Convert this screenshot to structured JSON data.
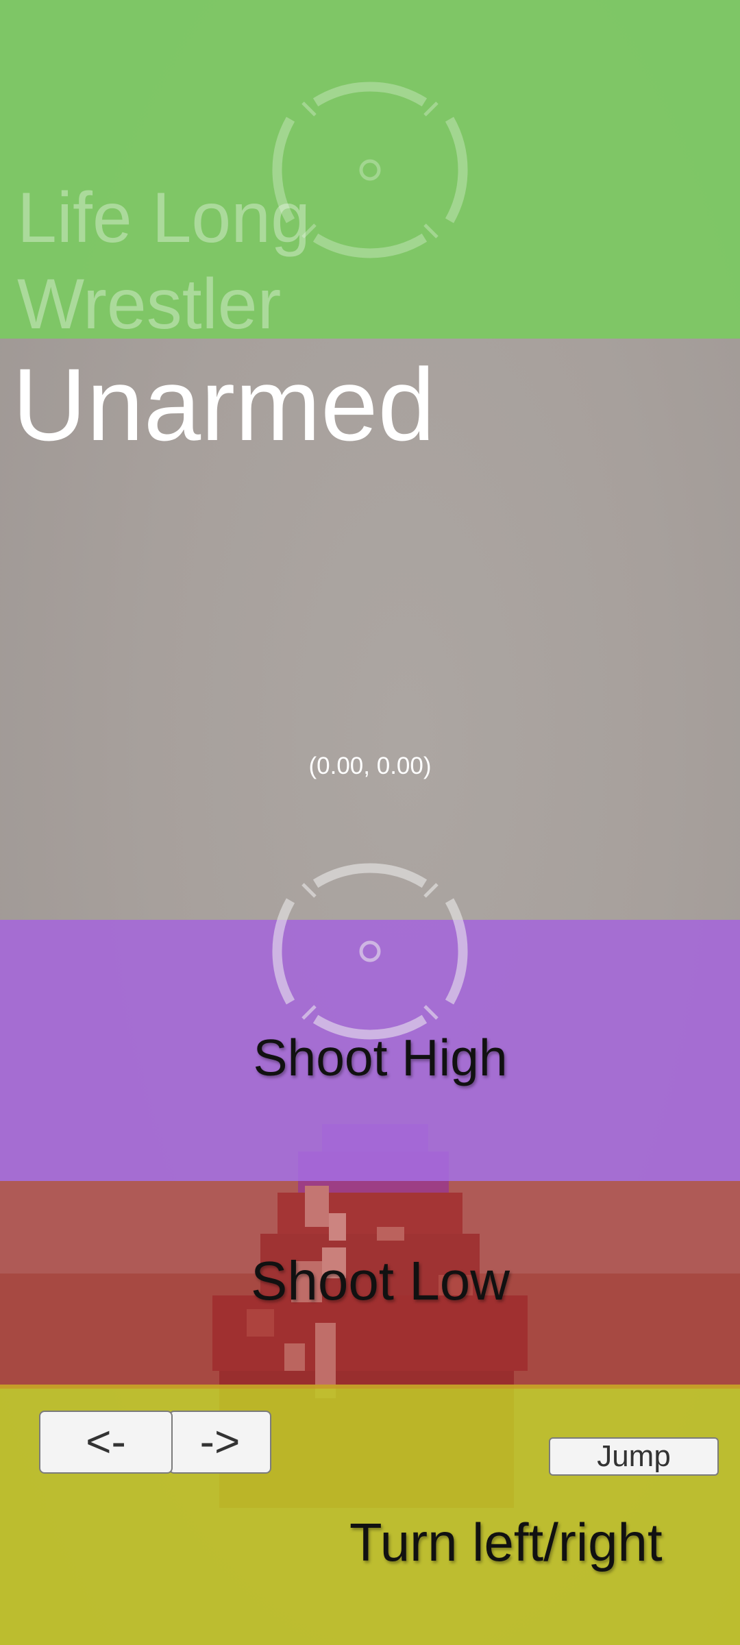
{
  "hud": {
    "character_name": "Life Long Wrestler",
    "weapon_name": "Unarmed",
    "aim_readout": "(0.00, 0.00)"
  },
  "zones": {
    "shoot_high_label": "Shoot High",
    "shoot_low_label": "Shoot Low",
    "turn_label": "Turn left/right"
  },
  "buttons": {
    "left_label": "<-",
    "right_label": "->",
    "jump_label": "Jump"
  },
  "icons": {
    "reticle": "crosshair-icon"
  },
  "colors": {
    "top_panel": "#7dc864",
    "shoot_high_zone": "#a569d7",
    "shoot_low_zone": "#aa3232",
    "move_zone": "#bec028",
    "scene_background": "#a9a29e"
  }
}
